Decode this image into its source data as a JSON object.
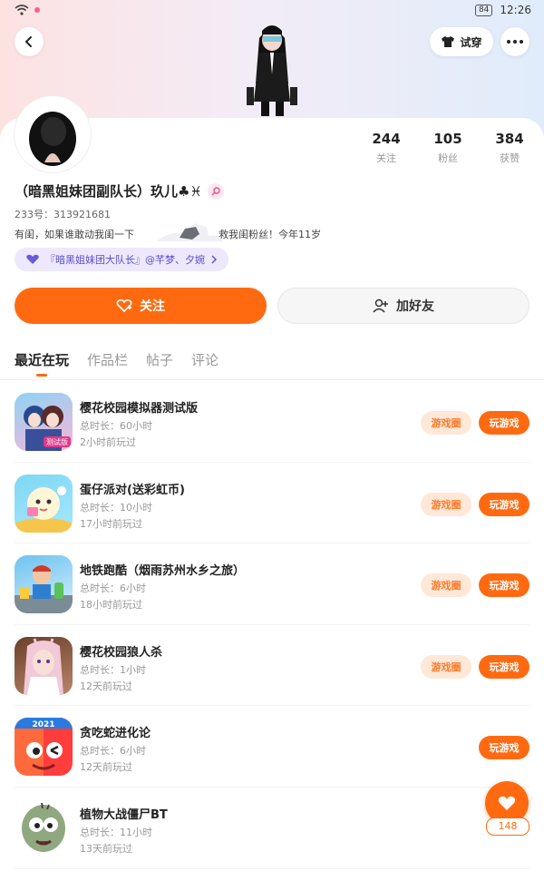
{
  "status_bar": {
    "time": "12:26",
    "battery": "84"
  },
  "header": {
    "try_on_label": "试穿"
  },
  "profile": {
    "name": "（暗黑姐妹团副队长）玖儿♣♓",
    "uid": "233号：313921681",
    "bio_left": "有闺，如果谁敢动我闺一下",
    "bio_right": "救我闺粉丝！今年11岁",
    "group_badge": "『暗黑姐妹团大队长』@芊梦、夕婉",
    "stats": [
      {
        "num": "244",
        "label": "关注"
      },
      {
        "num": "105",
        "label": "粉丝"
      },
      {
        "num": "384",
        "label": "获赞"
      }
    ],
    "follow_label": "关注",
    "add_friend_label": "加好友"
  },
  "tabs": [
    "最近在玩",
    "作品栏",
    "帖子",
    "评论"
  ],
  "games": [
    {
      "name": "樱花校园模拟器测试版",
      "duration": "总时长：60小时",
      "last_played": "2小时前玩过",
      "circle": "游戏圈",
      "play": "玩游戏"
    },
    {
      "name": "蛋仔派对(送彩虹币)",
      "duration": "总时长：10小时",
      "last_played": "17小时前玩过",
      "circle": "游戏圈",
      "play": "玩游戏"
    },
    {
      "name": "地铁跑酷（烟雨苏州水乡之旅）",
      "duration": "总时长：6小时",
      "last_played": "18小时前玩过",
      "circle": "游戏圈",
      "play": "玩游戏"
    },
    {
      "name": "樱花校园狼人杀",
      "duration": "总时长：1小时",
      "last_played": "12天前玩过",
      "circle": "游戏圈",
      "play": "玩游戏"
    },
    {
      "name": "贪吃蛇进化论",
      "duration": "总时长：6小时",
      "last_played": "12天前玩过",
      "play": "玩游戏"
    },
    {
      "name": "植物大战僵尸BT",
      "duration": "总时长：11小时",
      "last_played": "13天前玩过"
    }
  ],
  "icon_texts": {
    "sakura_test": "测试版",
    "snake_year": "2021"
  },
  "like_count": "148",
  "colors": {
    "accent": "#ff6a10",
    "badge_text": "#5a4fc7"
  },
  "icons": [
    "wifi-icon",
    "back-arrow-icon",
    "tshirt-icon",
    "more-icon",
    "heart-plus-icon",
    "person-add-icon",
    "heart-icon",
    "search-icon"
  ]
}
